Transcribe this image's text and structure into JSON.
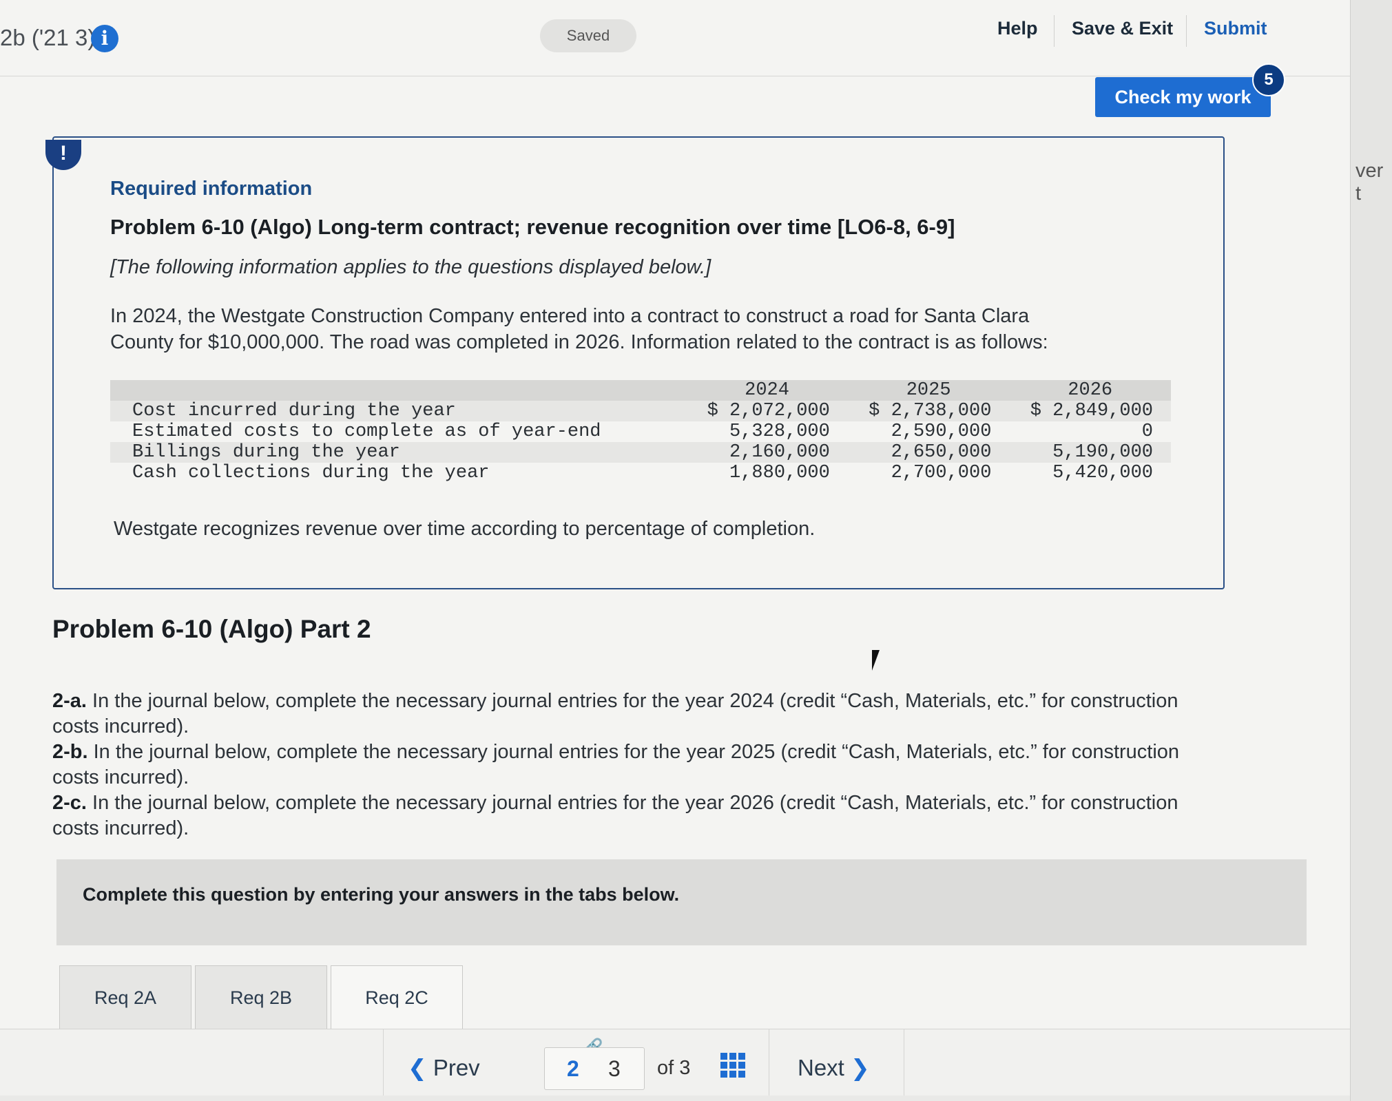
{
  "header": {
    "assignment_label": "2b ('21 3)",
    "saved_status": "Saved",
    "help": "Help",
    "save_exit": "Save & Exit",
    "submit": "Submit"
  },
  "check_work": {
    "label": "Check my work",
    "badge": "5"
  },
  "info_box": {
    "alert_glyph": "!",
    "required_info": "Required information",
    "problem_title": "Problem 6-10 (Algo) Long-term contract; revenue recognition over time [LO6-8, 6-9]",
    "note": "[The following information applies to the questions displayed below.]",
    "intro_line1": "In 2024, the Westgate Construction Company entered into a contract to construct a road for Santa Clara",
    "intro_line2": "County for $10,000,000. The road was completed in 2026. Information related to the contract is as follows:",
    "table": {
      "columns": [
        "2024",
        "2025",
        "2026"
      ],
      "rows": [
        {
          "label": "Cost incurred during the year",
          "values": [
            "$ 2,072,000",
            "$ 2,738,000",
            "$ 2,849,000"
          ]
        },
        {
          "label": "Estimated costs to complete as of year-end",
          "values": [
            "5,328,000",
            "2,590,000",
            "0"
          ]
        },
        {
          "label": "Billings during the year",
          "values": [
            "2,160,000",
            "2,650,000",
            "5,190,000"
          ]
        },
        {
          "label": "Cash collections during the year",
          "values": [
            "1,880,000",
            "2,700,000",
            "5,420,000"
          ]
        }
      ]
    },
    "closing": "Westgate recognizes revenue over time according to percentage of completion."
  },
  "part": {
    "title": "Problem 6-10 (Algo) Part 2",
    "items": [
      {
        "tag": "2-a.",
        "text": " In the journal below, complete the necessary journal entries for the year 2024 (credit “Cash, Materials, etc.” for construction costs incurred)."
      },
      {
        "tag": "2-b.",
        "text": " In the journal below, complete the necessary journal entries for the year 2025 (credit “Cash, Materials, etc.” for construction costs incurred)."
      },
      {
        "tag": "2-c.",
        "text": " In the journal below, complete the necessary journal entries for the year 2026 (credit “Cash, Materials, etc.” for construction costs incurred)."
      }
    ]
  },
  "complete_bar": "Complete this question by entering your answers in the tabs below.",
  "tabs": [
    "Req 2A",
    "Req 2B",
    "Req 2C"
  ],
  "nav": {
    "prev": "Prev",
    "current_page": "2",
    "next_page": "3",
    "of_total": "of 3",
    "next": "Next"
  },
  "peek_text": "ver t",
  "colors": {
    "accent": "#1e6dd2",
    "info_border": "#2a4f86",
    "heading_blue": "#1b4c86"
  }
}
